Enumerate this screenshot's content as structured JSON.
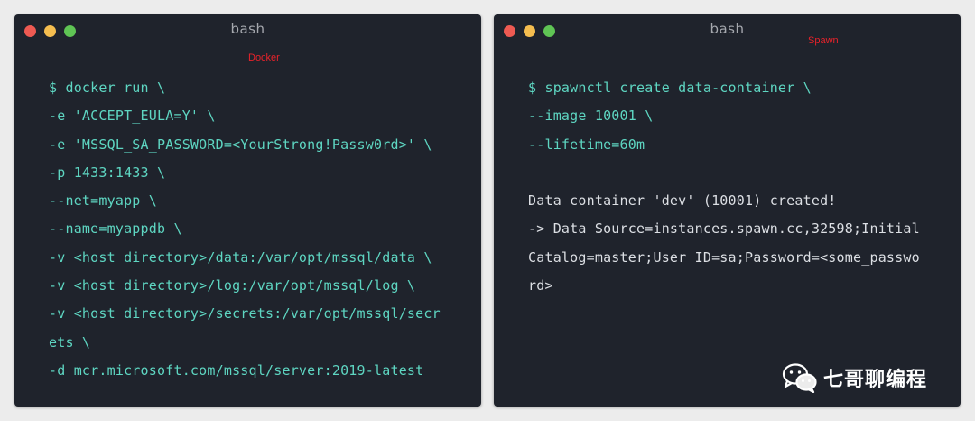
{
  "left_terminal": {
    "title": "bash",
    "annotation": "Docker",
    "lines": [
      "$ docker run \\",
      "-e 'ACCEPT_EULA=Y' \\",
      "-e 'MSSQL_SA_PASSWORD=<YourStrong!Passw0rd>' \\",
      "-p 1433:1433 \\",
      "--net=myapp \\",
      "--name=myappdb \\",
      "-v <host directory>/data:/var/opt/mssql/data \\",
      "-v <host directory>/log:/var/opt/mssql/log \\",
      "-v <host directory>/secrets:/var/opt/mssql/secr",
      "ets \\",
      "-d mcr.microsoft.com/mssql/server:2019-latest"
    ]
  },
  "right_terminal": {
    "title": "bash",
    "annotation": "Spawn",
    "lines": [
      "$ spawnctl create data-container \\",
      "--image 10001 \\",
      "--lifetime=60m",
      "",
      "Data container 'dev' (10001) created!",
      "-> Data Source=instances.spawn.cc,32598;Initial",
      "Catalog=master;User ID=sa;Password=<some_passwo",
      "rd>"
    ]
  },
  "watermark": {
    "text": "七哥聊编程",
    "icon": "wechat-icon"
  }
}
